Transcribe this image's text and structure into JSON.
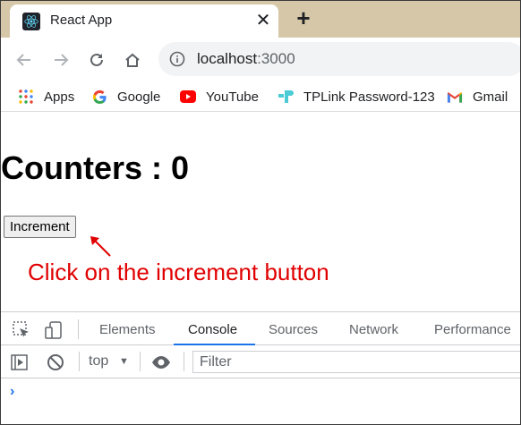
{
  "browser": {
    "tab": {
      "title": "React App",
      "close_glyph": "✕",
      "favicon": "react-logo-icon"
    },
    "new_tab_glyph": "+",
    "address": {
      "host": "localhost",
      "port": ":3000"
    },
    "bookmarks": [
      {
        "label": "Apps",
        "icon": "apps-grid-icon"
      },
      {
        "label": "Google",
        "icon": "google-icon"
      },
      {
        "label": "YouTube",
        "icon": "youtube-icon"
      },
      {
        "label": "TPLink Password-123",
        "icon": "tplink-icon"
      },
      {
        "label": "Gmail",
        "icon": "gmail-icon"
      }
    ]
  },
  "page": {
    "heading": "Counters : 0",
    "increment_label": "Increment",
    "annotation": "Click on the increment button"
  },
  "devtools": {
    "tabs": [
      "Elements",
      "Console",
      "Sources",
      "Network",
      "Performance"
    ],
    "active_tab": "Console",
    "context": "top",
    "filter_placeholder": "Filter",
    "prompt": "›"
  },
  "colors": {
    "tab_strip": "#d6c7a8",
    "annotation": "#e00000",
    "active_tab_underline": "#1a73e8"
  }
}
